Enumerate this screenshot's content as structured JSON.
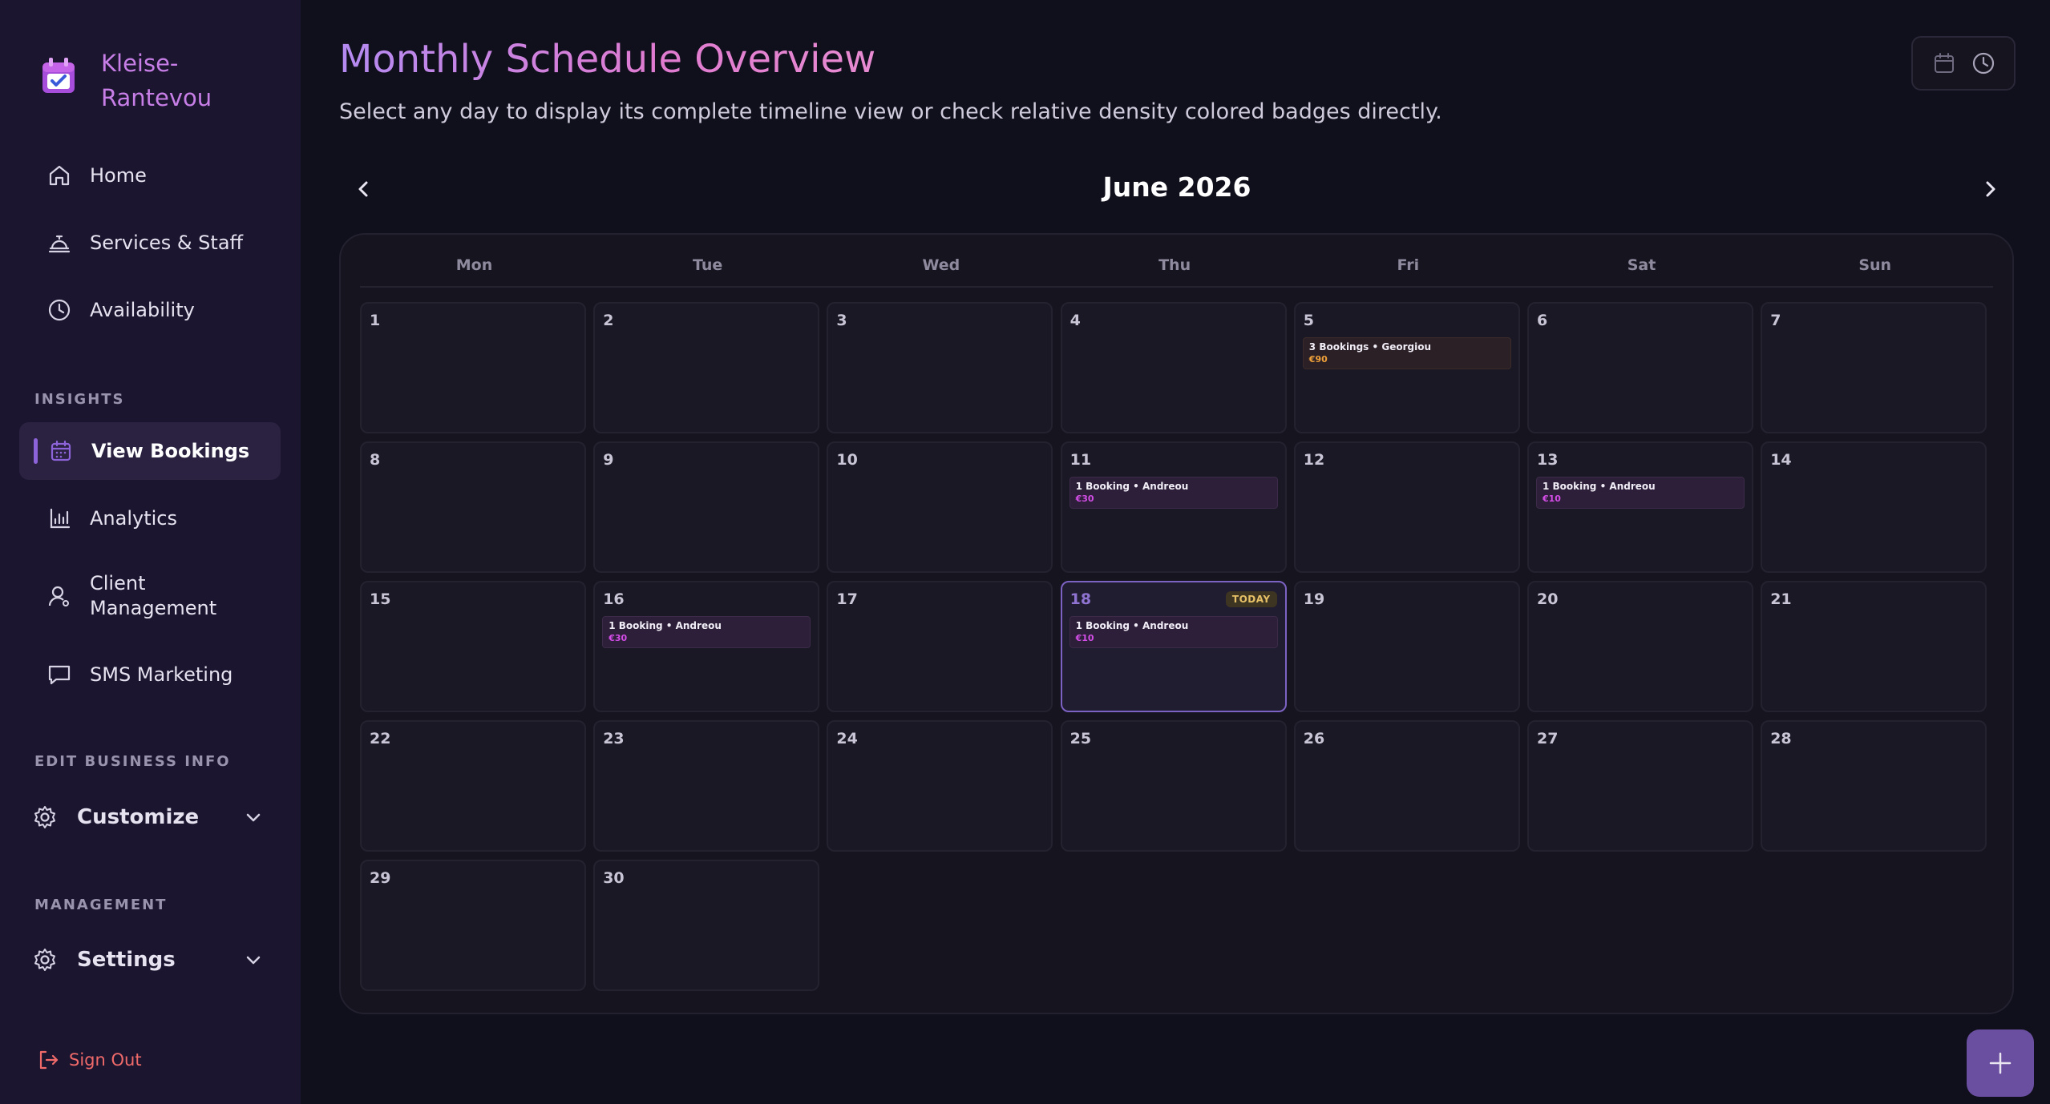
{
  "brand": {
    "name": "Kleise-Rantevou"
  },
  "sidebar": {
    "items": [
      {
        "label": "Home",
        "icon": "home-icon"
      },
      {
        "label": "Services & Staff",
        "icon": "service-bell-icon"
      },
      {
        "label": "Availability",
        "icon": "clock-icon"
      },
      {
        "label": "View Bookings",
        "icon": "calendar-icon"
      },
      {
        "label": "Analytics",
        "icon": "bar-chart-icon"
      },
      {
        "label": "Client Management",
        "icon": "user-icon"
      },
      {
        "label": "SMS Marketing",
        "icon": "message-icon"
      }
    ],
    "sections": {
      "insights": "INSIGHTS",
      "edit_business": "EDIT BUSINESS INFO",
      "management": "MANAGEMENT"
    },
    "customize": "Customize",
    "settings": "Settings",
    "sign_out": "Sign Out"
  },
  "header": {
    "title": "Monthly Schedule Overview",
    "subtitle": "Select any day to display its complete timeline view or check relative density colored badges directly."
  },
  "calendar": {
    "month_label": "June 2026",
    "weekdays": [
      "Mon",
      "Tue",
      "Wed",
      "Thu",
      "Fri",
      "Sat",
      "Sun"
    ],
    "today_label": "TODAY",
    "days": [
      {
        "n": "1"
      },
      {
        "n": "2"
      },
      {
        "n": "3"
      },
      {
        "n": "4"
      },
      {
        "n": "5",
        "booking": "3 Bookings • Georgiou",
        "price": "€90",
        "tone": "amber"
      },
      {
        "n": "6"
      },
      {
        "n": "7"
      },
      {
        "n": "8"
      },
      {
        "n": "9"
      },
      {
        "n": "10"
      },
      {
        "n": "11",
        "booking": "1 Booking • Andreou",
        "price": "€30",
        "tone": "purple"
      },
      {
        "n": "12"
      },
      {
        "n": "13",
        "booking": "1 Booking • Andreou",
        "price": "€10",
        "tone": "purple"
      },
      {
        "n": "14"
      },
      {
        "n": "15"
      },
      {
        "n": "16",
        "booking": "1 Booking • Andreou",
        "price": "€30",
        "tone": "purple"
      },
      {
        "n": "17"
      },
      {
        "n": "18",
        "booking": "1 Booking • Andreou",
        "price": "€10",
        "tone": "purple",
        "today": true
      },
      {
        "n": "19"
      },
      {
        "n": "20"
      },
      {
        "n": "21"
      },
      {
        "n": "22"
      },
      {
        "n": "23"
      },
      {
        "n": "24"
      },
      {
        "n": "25"
      },
      {
        "n": "26"
      },
      {
        "n": "27"
      },
      {
        "n": "28"
      },
      {
        "n": "29"
      },
      {
        "n": "30"
      }
    ]
  },
  "colors": {
    "accent": "#8c63d8",
    "brand": "#c77ee6",
    "danger": "#f06a6a",
    "amber": "#f0a13a",
    "magenta": "#d34de6"
  }
}
